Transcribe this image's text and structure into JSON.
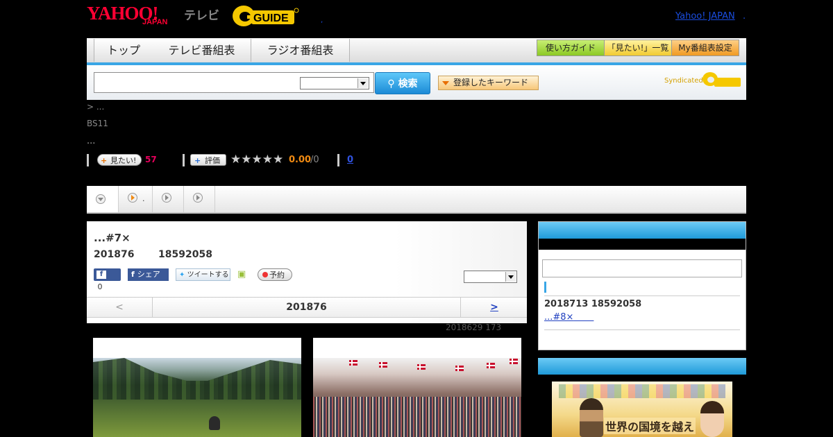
{
  "header": {
    "yahoo_logo": "YAHOO!",
    "japan_logo": "JAPAN",
    "tv_label": "テレビ",
    "gguide_logo": "GUIDE",
    "yahoo_japan_link": "Yahoo! JAPAN",
    "link_dot": ".",
    "small_dot": ","
  },
  "nav": {
    "tabs": [
      "トップ",
      "テレビ番組表",
      "ラジオ番組表"
    ],
    "guide_button": "使い方ガイド",
    "mitai_list_button": "「見たい!」一覧",
    "my_schedule_button": "My番組表設定"
  },
  "search": {
    "input_value": "",
    "button_label": "検索",
    "keyword_button": "登録したキーワード",
    "syndicated": "Syndicated"
  },
  "info": {
    "breadcrumb": "> ...",
    "station": "BS11",
    "dots": "...",
    "mitai_label": "見たい!",
    "mitai_count": "57",
    "rate_label": "評価",
    "stars": "★★★★★",
    "score": "0.00",
    "score_total": "/0",
    "review_count": "0"
  },
  "tabs": {
    "dot": "."
  },
  "program": {
    "title": "...#7×",
    "date": "201876",
    "time": "18592058",
    "fb_like_count": "0",
    "fb_share": "シェア",
    "tweet": "ツイートする",
    "yoyaku": "予約",
    "prev": "<",
    "current_date": "201876",
    "next": ">",
    "updated": "2018629  173"
  },
  "sidebar": {
    "next_date": "2018713  18592058",
    "next_link": "...#8×"
  },
  "colors": {
    "accent_blue": "#39a6e6",
    "yahoo_red": "#ff0033",
    "score_orange": "#f08a12",
    "count_pink": "#e6005c"
  }
}
